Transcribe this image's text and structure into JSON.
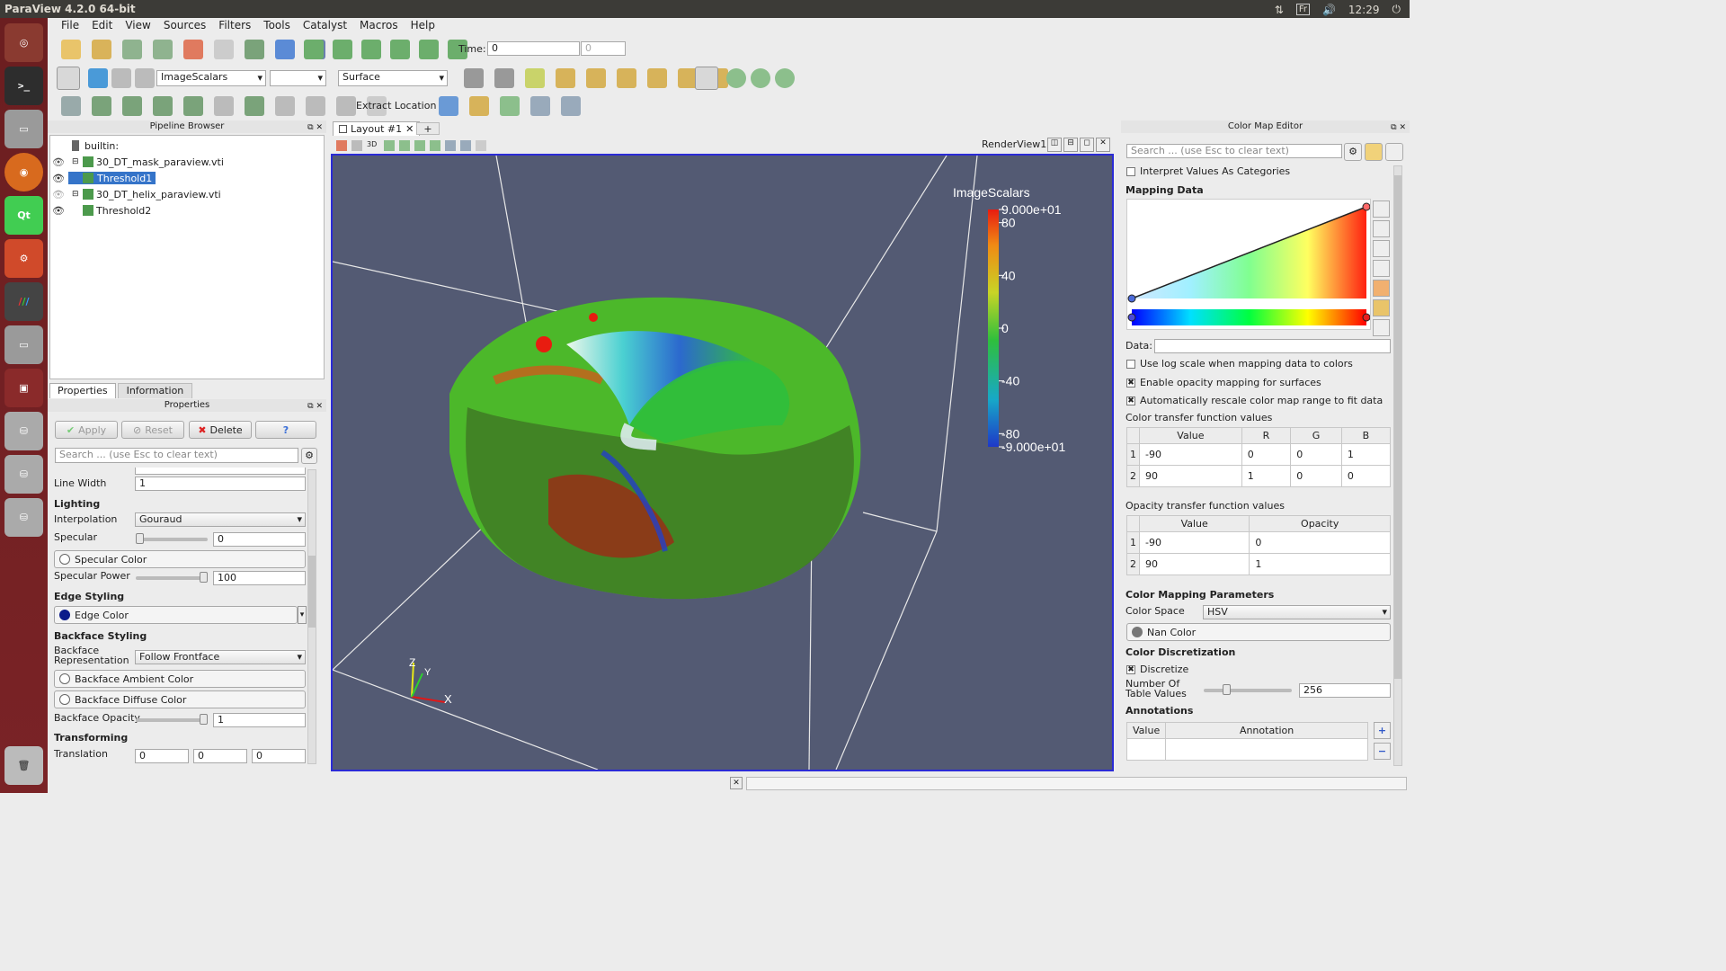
{
  "window_title": "ParaView 4.2.0 64-bit",
  "tray": {
    "lang": "Fr",
    "clock": "12:29"
  },
  "menu": [
    "File",
    "Edit",
    "View",
    "Sources",
    "Filters",
    "Tools",
    "Catalyst",
    "Macros",
    "Help"
  ],
  "toolbar": {
    "time_label": "Time:",
    "time_value": "0",
    "time_index": "0",
    "color_by": "ImageScalars",
    "representation": "Surface",
    "extract_location": "Extract Location"
  },
  "pipeline": {
    "title": "Pipeline Browser",
    "root": "builtin:",
    "items": [
      "30_DT_mask_paraview.vti",
      "Threshold1",
      "30_DT_helix_paraview.vti",
      "Threshold2"
    ]
  },
  "tabs": {
    "properties": "Properties",
    "information": "Information"
  },
  "properties": {
    "title": "Properties",
    "apply": "Apply",
    "reset": "Reset",
    "delete": "Delete",
    "help": "?",
    "search_placeholder": "Search ... (use Esc to clear text)",
    "line_width_label": "Line Width",
    "line_width": "1",
    "lighting": "Lighting",
    "interpolation_label": "Interpolation",
    "interpolation": "Gouraud",
    "specular_label": "Specular",
    "specular": "0",
    "specular_color": "Specular Color",
    "specular_power_label": "Specular Power",
    "specular_power": "100",
    "edge_styling": "Edge Styling",
    "edge_color": "Edge Color",
    "backface_styling": "Backface Styling",
    "backface_rep_label": "Backface Representation",
    "backface_rep": "Follow Frontface",
    "backface_ambient": "Backface Ambient Color",
    "backface_diffuse": "Backface Diffuse Color",
    "backface_opacity_label": "Backface Opacity",
    "backface_opacity": "1",
    "transforming": "Transforming",
    "translation_label": "Translation",
    "translation": [
      "0",
      "0",
      "0"
    ]
  },
  "layout": {
    "tab": "Layout #1",
    "add": "+",
    "view_name": "RenderView1"
  },
  "legend": {
    "title": "ImageScalars",
    "max": "9.000e+01",
    "min": "-9.000e+01",
    "ticks": [
      "80",
      "40",
      "0",
      "-40",
      "-80"
    ]
  },
  "axes": {
    "x": "X",
    "y": "Y",
    "z": "Z"
  },
  "cme": {
    "title": "Color Map Editor",
    "search_placeholder": "Search ... (use Esc to clear text)",
    "interpret": "Interpret Values As Categories",
    "mapping_data": "Mapping Data",
    "data_label": "Data:",
    "log_scale": "Use log scale when mapping data to colors",
    "enable_opacity": "Enable opacity mapping for surfaces",
    "auto_rescale": "Automatically rescale color map range to fit data",
    "ctf_title": "Color transfer function values",
    "ctf_headers": [
      "Value",
      "R",
      "G",
      "B"
    ],
    "ctf_rows": [
      [
        "1",
        "-90",
        "0",
        "0",
        "1"
      ],
      [
        "2",
        "90",
        "1",
        "0",
        "0"
      ]
    ],
    "otf_title": "Opacity transfer function values",
    "otf_headers": [
      "Value",
      "Opacity"
    ],
    "otf_rows": [
      [
        "1",
        "-90",
        "0"
      ],
      [
        "2",
        "90",
        "1"
      ]
    ],
    "params_title": "Color Mapping Parameters",
    "color_space_label": "Color Space",
    "color_space": "HSV",
    "nan_color": "Nan Color",
    "discretization": "Color Discretization",
    "discretize": "Discretize",
    "num_table_label": "Number Of Table Values",
    "num_table": "256",
    "annotations": "Annotations",
    "ann_headers": [
      "Value",
      "Annotation"
    ]
  },
  "colors": {
    "accent_blue": "#2b2bd6",
    "viewport_bg": "#535a73",
    "launcher": "#6b1e20"
  }
}
